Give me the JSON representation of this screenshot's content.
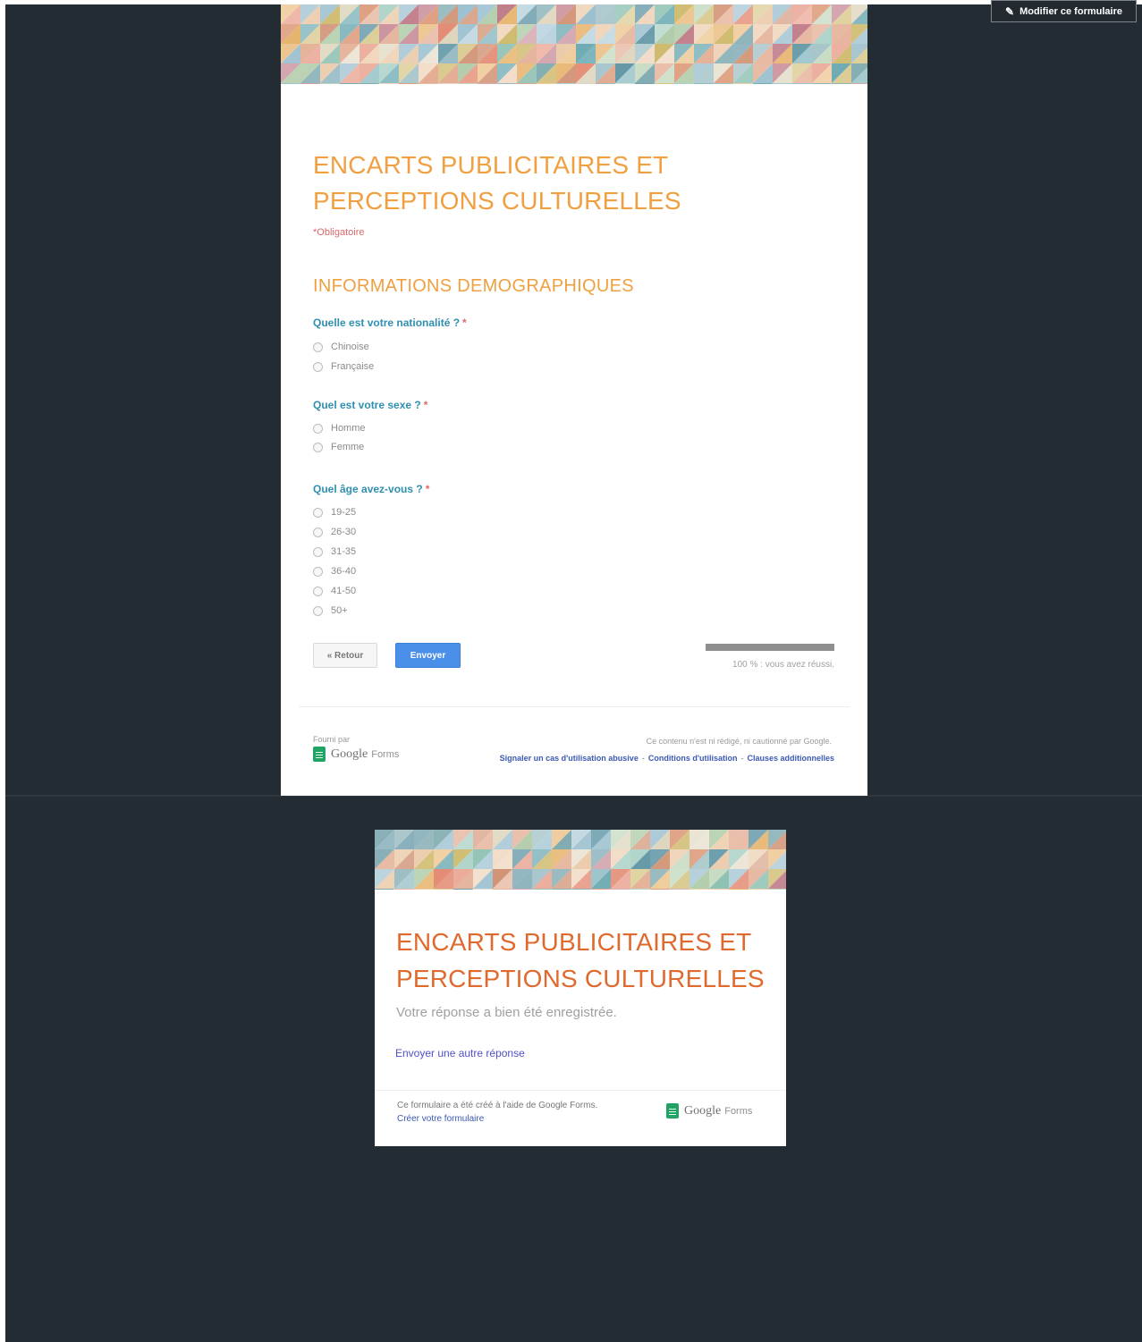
{
  "header": {
    "edit_button_label": "Modifier ce formulaire",
    "edit_icon": "pencil-icon"
  },
  "form": {
    "title_line1": "ENCARTS PUBLICITAIRES ET",
    "title_line2": "PERCEPTIONS CULTURELLES",
    "required_note": "*Obligatoire",
    "section_title": "INFORMATIONS DEMOGRAPHIQUES",
    "questions": [
      {
        "label": "Quelle est votre nationalité ?",
        "required": "*",
        "options": [
          "Chinoise",
          "Française"
        ]
      },
      {
        "label": "Quel est votre sexe ?",
        "required": "*",
        "options": [
          "Homme",
          "Femme"
        ]
      },
      {
        "label": "Quel âge avez-vous ?",
        "required": "*",
        "options": [
          "19-25",
          "26-30",
          "31-35",
          "36-40",
          "41-50",
          "50+"
        ]
      }
    ],
    "back_button": "« Retour",
    "submit_button": "Envoyer",
    "progress_percent": 100,
    "progress_text": "100 % : vous avez réussi.",
    "footer": {
      "powered_by": "Fourni par",
      "google_text": "Google",
      "forms_text": "Forms",
      "note": "Ce contenu n'est ni rédigé, ni cautionné par Google.",
      "links": [
        "Signaler un cas d'utilisation abusive",
        "Conditions d'utilisation",
        "Clauses additionnelles"
      ],
      "link_separator": "-"
    }
  },
  "confirmation": {
    "title_line1": "ENCARTS PUBLICITAIRES ET",
    "title_line2": "PERCEPTIONS CULTURELLES",
    "message": "Votre réponse a bien été enregistrée.",
    "other_response_link": "Envoyer une autre réponse",
    "created_with": "Ce formulaire a été créé à l'aide de Google Forms.",
    "create_link": "Créer votre formulaire",
    "google_text": "Google",
    "forms_text": "Forms"
  },
  "colors": {
    "page_background": "#232c33",
    "title_orange": "#f0a040",
    "confirm_title": "#e0692e",
    "question_teal": "#2f8fb0",
    "submit_blue": "#4a8fea",
    "link_blue": "#3b59b5",
    "forms_green": "#1fa463"
  }
}
